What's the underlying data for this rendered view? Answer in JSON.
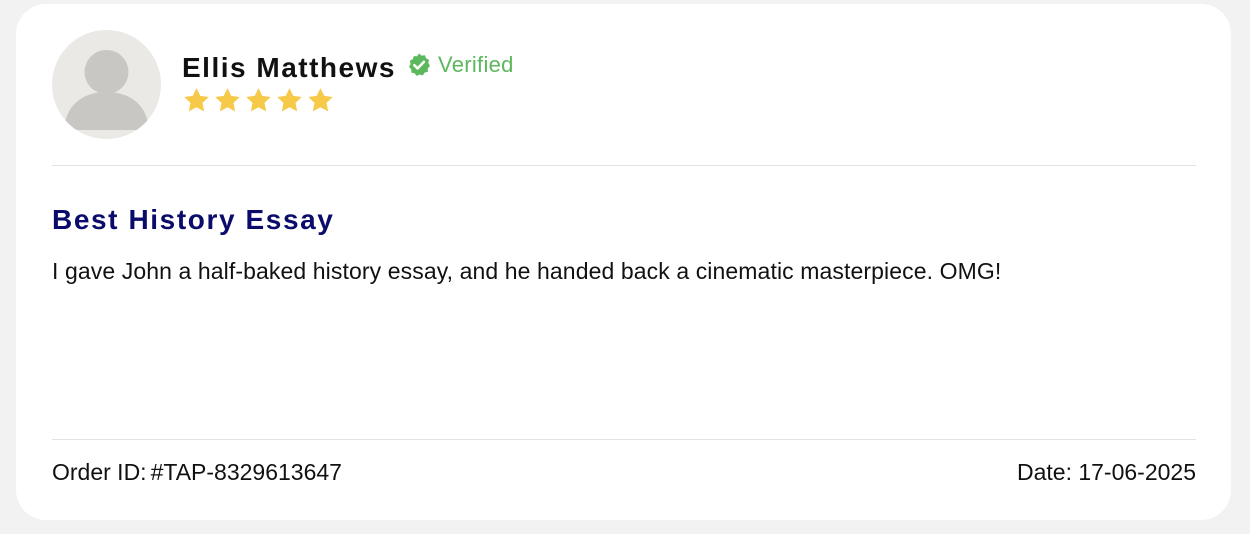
{
  "review": {
    "reviewer_name": "Ellis Matthews",
    "verified_label": "Verified",
    "rating": 5,
    "rating_max": 5,
    "title": "Best History Essay",
    "body": "I gave John a half-baked history essay, and he handed back a cinematic masterpiece. OMG!",
    "order_label": "Order ID:",
    "order_id": "#TAP-8329613647",
    "date_text": "Date: 17-06-2025"
  },
  "icons": {
    "avatar": "user-silhouette-icon",
    "verified": "verified-badge-icon",
    "star": "star-icon"
  },
  "colors": {
    "verified_green": "#5cb85c",
    "star_gold": "#f7c948",
    "title_navy": "#0b0b6b",
    "avatar_bg": "#ebe9e6",
    "avatar_figure": "#c9c7c4"
  }
}
